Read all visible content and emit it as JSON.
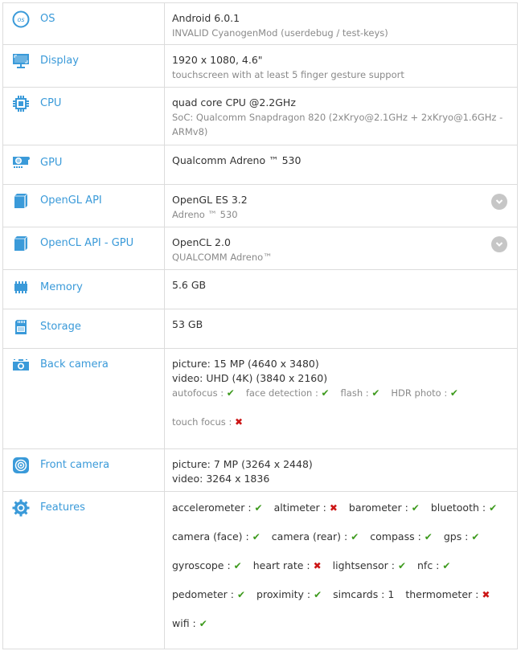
{
  "accent_color": "#3a9ad9",
  "ok_color": "#3d9a1d",
  "no_color": "#cc1616",
  "rows": [
    {
      "label": "OS",
      "icon": "os-icon",
      "primary": "Android 6.0.1",
      "secondary": "INVALID CyanogenMod (userdebug / test-keys)"
    },
    {
      "label": "Display",
      "icon": "monitor-icon",
      "primary": "1920 x 1080, 4.6\"",
      "secondary": "touchscreen with at least 5 finger gesture support"
    },
    {
      "label": "CPU",
      "icon": "cpu-chip-icon",
      "primary": "quad core CPU @2.2GHz",
      "secondary": "SoC: Qualcomm Snapdragon 820 (2xKryo@2.1GHz + 2xKryo@1.6GHz - ARMv8)"
    },
    {
      "label": "GPU",
      "icon": "gpu-card-icon",
      "primary": "Qualcomm Adreno ™ 530"
    },
    {
      "label": "OpenGL API",
      "icon": "cube-icon",
      "primary": "OpenGL ES 3.2",
      "secondary": "Adreno ™ 530",
      "expandable": true
    },
    {
      "label": "OpenCL API - GPU",
      "icon": "cube-icon",
      "primary": "OpenCL 2.0",
      "secondary": "QUALCOMM Adreno™",
      "expandable": true
    },
    {
      "label": "Memory",
      "icon": "memory-icon",
      "primary": "5.6 GB"
    },
    {
      "label": "Storage",
      "icon": "sd-card-icon",
      "primary": "53 GB"
    },
    {
      "label": "Back camera",
      "icon": "camera-icon",
      "picture": "picture: 15 MP (4640 x 3480)",
      "video": "video: UHD (4K) (3840 x 2160)",
      "features": [
        {
          "name": "autofocus :",
          "status": "yes"
        },
        {
          "name": "face detection :",
          "status": "yes"
        },
        {
          "name": "flash :",
          "status": "yes"
        },
        {
          "name": "HDR photo :",
          "status": "yes"
        },
        {
          "name": "touch focus :",
          "status": "no"
        }
      ]
    },
    {
      "label": "Front camera",
      "icon": "front-camera-icon",
      "picture": "picture: 7 MP (3264 x 2448)",
      "video": "video: 3264 x 1836"
    },
    {
      "label": "Features",
      "icon": "gear-icon",
      "features": [
        {
          "name": "accelerometer :",
          "status": "yes"
        },
        {
          "name": "altimeter :",
          "status": "no"
        },
        {
          "name": "barometer :",
          "status": "yes"
        },
        {
          "name": "bluetooth :",
          "status": "yes"
        },
        {
          "name": "camera (face) :",
          "status": "yes"
        },
        {
          "name": "camera (rear) :",
          "status": "yes"
        },
        {
          "name": "compass :",
          "status": "yes"
        },
        {
          "name": "gps :",
          "status": "yes"
        },
        {
          "name": "gyroscope :",
          "status": "yes"
        },
        {
          "name": "heart rate :",
          "status": "no"
        },
        {
          "name": "lightsensor :",
          "status": "yes"
        },
        {
          "name": "nfc :",
          "status": "yes"
        },
        {
          "name": "pedometer :",
          "status": "yes"
        },
        {
          "name": "proximity :",
          "status": "yes"
        },
        {
          "name": "simcards : 1",
          "status": ""
        },
        {
          "name": "thermometer :",
          "status": "no"
        },
        {
          "name": "wifi :",
          "status": "yes"
        }
      ]
    }
  ],
  "symbols": {
    "yes": "✔",
    "no": "✖"
  }
}
